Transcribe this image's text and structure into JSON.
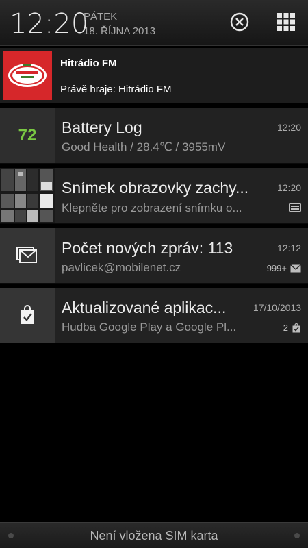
{
  "header": {
    "time": "12:20",
    "day": "PÁTEK",
    "date": "18. ŘÍJNA 2013"
  },
  "notifications": {
    "media": {
      "station": "Hitrádio FM",
      "now_playing": "Právě hraje: Hitrádio FM",
      "logo_icon": "hitradio-logo"
    },
    "battery": {
      "level": "72",
      "title": "Battery Log",
      "subtitle": "Good Health / 28.4℃ / 3955mV",
      "time": "12:20"
    },
    "screenshot": {
      "title": "Snímek obrazovky zachy...",
      "subtitle": "Klepněte pro zobrazení snímku o...",
      "time": "12:20"
    },
    "gmail": {
      "title": "Počet nových zpráv: 113",
      "subtitle": "pavlicek@mobilenet.cz",
      "time": "12:12",
      "count": "999+"
    },
    "play": {
      "title": "Aktualizované aplikac...",
      "subtitle": "Hudba Google Play a Google Pl...",
      "time": "17/10/2013",
      "count": "2"
    }
  },
  "footer": {
    "sim_status": "Není vložena SIM karta"
  },
  "colors": {
    "battery_green": "#7ac943",
    "logo_red": "#d6272a"
  }
}
